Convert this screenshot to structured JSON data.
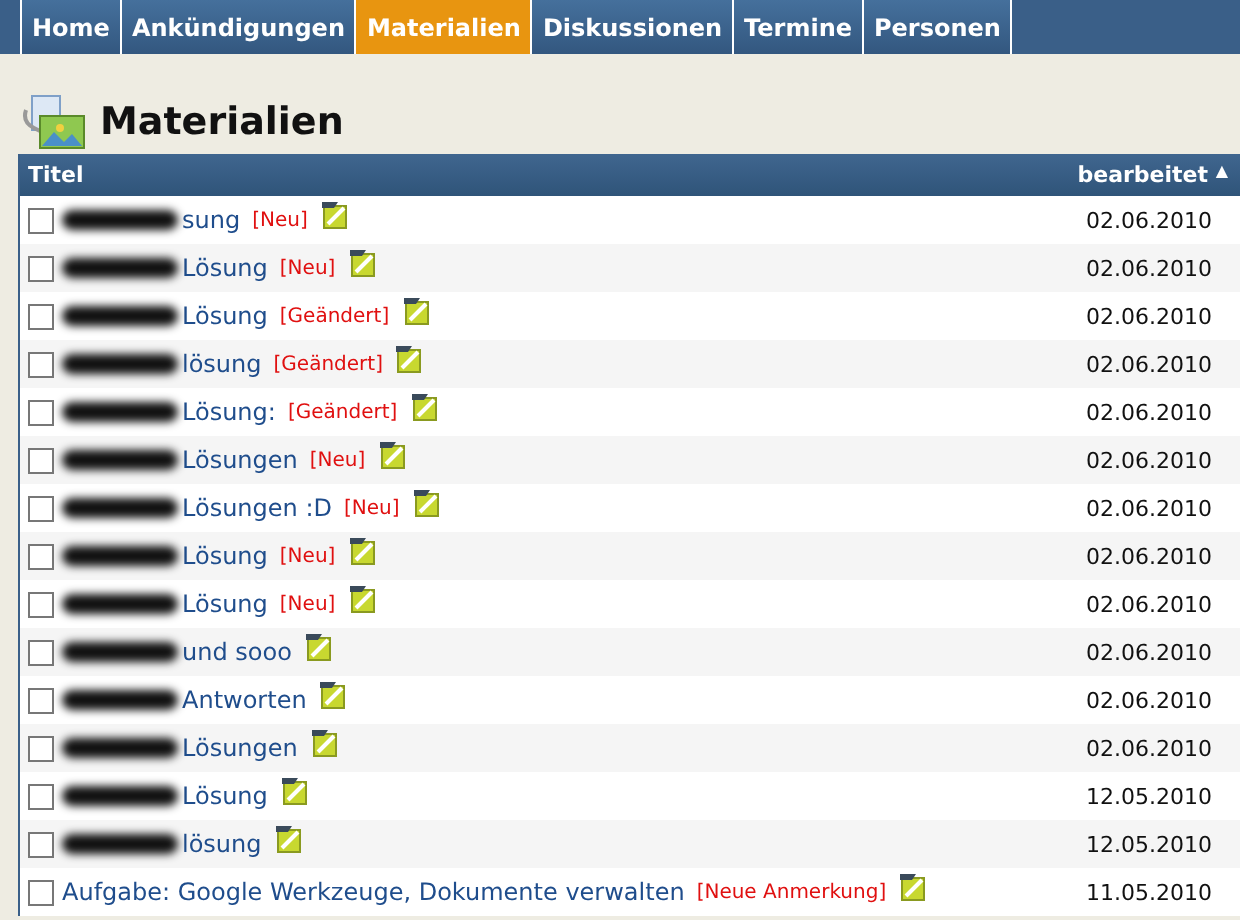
{
  "tabs": [
    {
      "label": "Home",
      "selected": false
    },
    {
      "label": "Ankündigungen",
      "selected": false
    },
    {
      "label": "Materialien",
      "selected": true
    },
    {
      "label": "Diskussionen",
      "selected": false
    },
    {
      "label": "Termine",
      "selected": false
    },
    {
      "label": "Personen",
      "selected": false
    }
  ],
  "page_title": "Materialien",
  "table": {
    "columns": [
      {
        "label": "Titel"
      },
      {
        "label": "bearbeitet",
        "sort": "▲"
      }
    ],
    "rows": [
      {
        "checked": false,
        "redacted": true,
        "title": "sung",
        "tag": "[Neu]",
        "date": "02.06.2010"
      },
      {
        "checked": false,
        "redacted": true,
        "title": "Lösung",
        "tag": "[Neu]",
        "date": "02.06.2010"
      },
      {
        "checked": false,
        "redacted": true,
        "title": "Lösung",
        "tag": "[Geändert]",
        "date": "02.06.2010"
      },
      {
        "checked": false,
        "redacted": true,
        "title": "lösung",
        "tag": "[Geändert]",
        "date": "02.06.2010"
      },
      {
        "checked": false,
        "redacted": true,
        "title": "Lösung:",
        "tag": "[Geändert]",
        "date": "02.06.2010"
      },
      {
        "checked": false,
        "redacted": true,
        "title": "Lösungen",
        "tag": "[Neu]",
        "date": "02.06.2010"
      },
      {
        "checked": false,
        "redacted": true,
        "title": "Lösungen :D",
        "tag": "[Neu]",
        "date": "02.06.2010"
      },
      {
        "checked": false,
        "redacted": true,
        "title": "Lösung",
        "tag": "[Neu]",
        "date": "02.06.2010"
      },
      {
        "checked": false,
        "redacted": true,
        "title": "Lösung",
        "tag": "[Neu]",
        "date": "02.06.2010"
      },
      {
        "checked": false,
        "redacted": true,
        "title": "und sooo",
        "date": "02.06.2010"
      },
      {
        "checked": false,
        "redacted": true,
        "title": "Antworten",
        "date": "02.06.2010"
      },
      {
        "checked": false,
        "redacted": true,
        "title": "Lösungen",
        "date": "02.06.2010"
      },
      {
        "checked": false,
        "redacted": true,
        "title": "Lösung",
        "date": "12.05.2010"
      },
      {
        "checked": false,
        "redacted": true,
        "title": "lösung",
        "date": "12.05.2010"
      },
      {
        "checked": false,
        "redacted": false,
        "title": "Aufgabe: Google Werkzeuge, Dokumente verwalten",
        "tag": "[Neue Anmerkung]",
        "date": "11.05.2010"
      }
    ]
  }
}
